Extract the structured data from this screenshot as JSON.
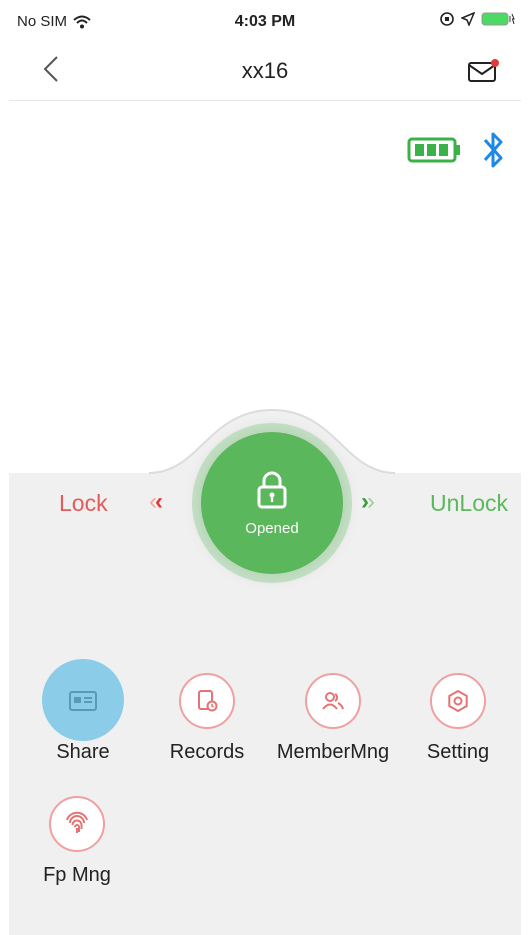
{
  "status_bar": {
    "carrier": "No SIM",
    "time": "4:03 PM"
  },
  "nav": {
    "title": "xx16",
    "back_icon": "chevron-left-icon",
    "mail_icon": "mail-icon"
  },
  "device": {
    "battery_icon": "battery-full-icon",
    "bluetooth_icon": "bluetooth-icon"
  },
  "control": {
    "lock_label": "Lock",
    "unlock_label": "UnLock",
    "status_text": "Opened",
    "lock_color": "#e55a5a",
    "unlock_color": "#5cb85c",
    "button_color": "#5bb75b"
  },
  "menu": {
    "items": [
      {
        "label": "Share",
        "icon": "share-card-icon"
      },
      {
        "label": "Records",
        "icon": "records-icon"
      },
      {
        "label": "MemberMng",
        "icon": "members-icon"
      },
      {
        "label": "Setting",
        "icon": "settings-gear-icon"
      },
      {
        "label": "Fp Mng",
        "icon": "fingerprint-icon"
      }
    ]
  }
}
